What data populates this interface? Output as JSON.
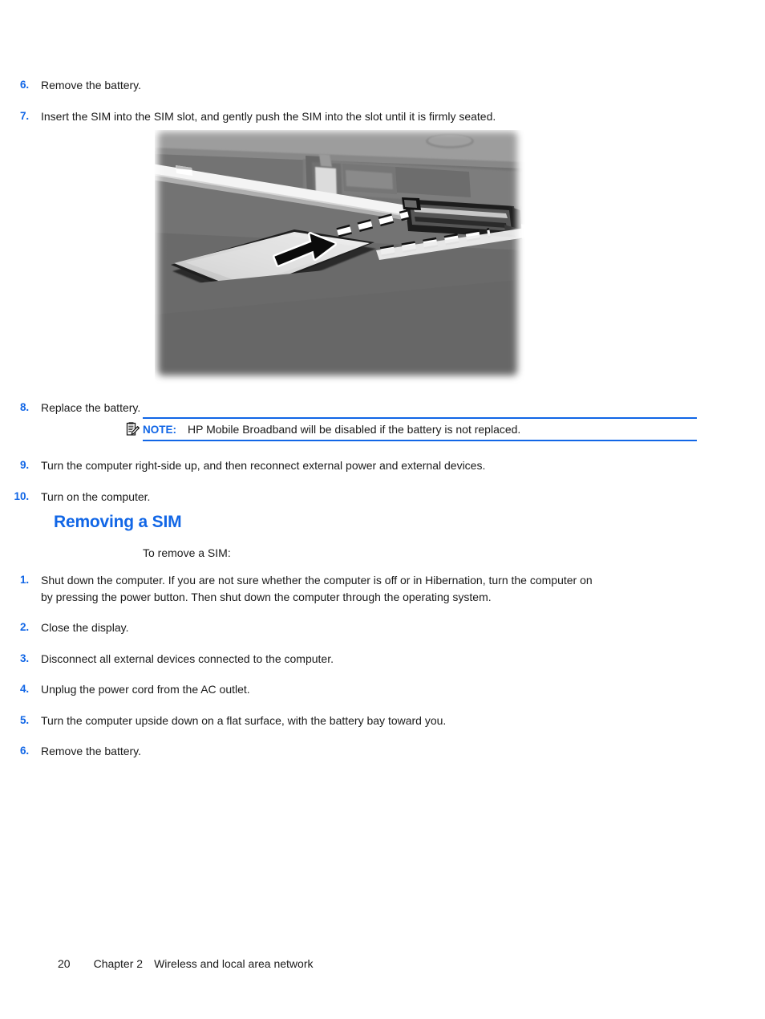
{
  "document": {
    "heading": "Removing a SIM",
    "intro": "To remove a SIM:"
  },
  "steps_top": [
    {
      "num": "6.",
      "text": "Remove the battery."
    },
    {
      "num": "7.",
      "text": "Insert the SIM into the SIM slot, and gently push the SIM into the slot until it is firmly seated."
    }
  ],
  "steps_mid": [
    {
      "num": "8.",
      "text": "Replace the battery."
    }
  ],
  "steps_after_note": [
    {
      "num": "9.",
      "text": "Turn the computer right-side up, and then reconnect external power and external devices."
    },
    {
      "num": "10.",
      "text": "Turn on the computer."
    }
  ],
  "steps_removing": [
    {
      "num": "1.",
      "text": "Shut down the computer. If you are not sure whether the computer is off or in Hibernation, turn the computer on by pressing the power button. Then shut down the computer through the operating system."
    },
    {
      "num": "2.",
      "text": "Close the display."
    },
    {
      "num": "3.",
      "text": "Disconnect all external devices connected to the computer."
    },
    {
      "num": "4.",
      "text": "Unplug the power cord from the AC outlet."
    },
    {
      "num": "5.",
      "text": "Turn the computer upside down on a flat surface, with the battery bay toward you."
    },
    {
      "num": "6.",
      "text": "Remove the battery."
    }
  ],
  "note": {
    "label": "NOTE:",
    "text": "HP Mobile Broadband will be disabled if the battery is not replaced.",
    "icon": "note-clipboard-icon",
    "rule_color": "#1166e6"
  },
  "figure": {
    "caption": "Photograph of a laptop underside showing a SIM card being inserted into the SIM slot with a directional arrow and dashed guide path",
    "alt_name": "sim-insertion-photo"
  },
  "footer": {
    "page_number": "20",
    "chapter": "Chapter 2",
    "chapter_title": "Wireless and local area network"
  },
  "colors": {
    "accent_blue": "#1166e6",
    "body_text": "#1a1a1a",
    "background": "#ffffff"
  }
}
